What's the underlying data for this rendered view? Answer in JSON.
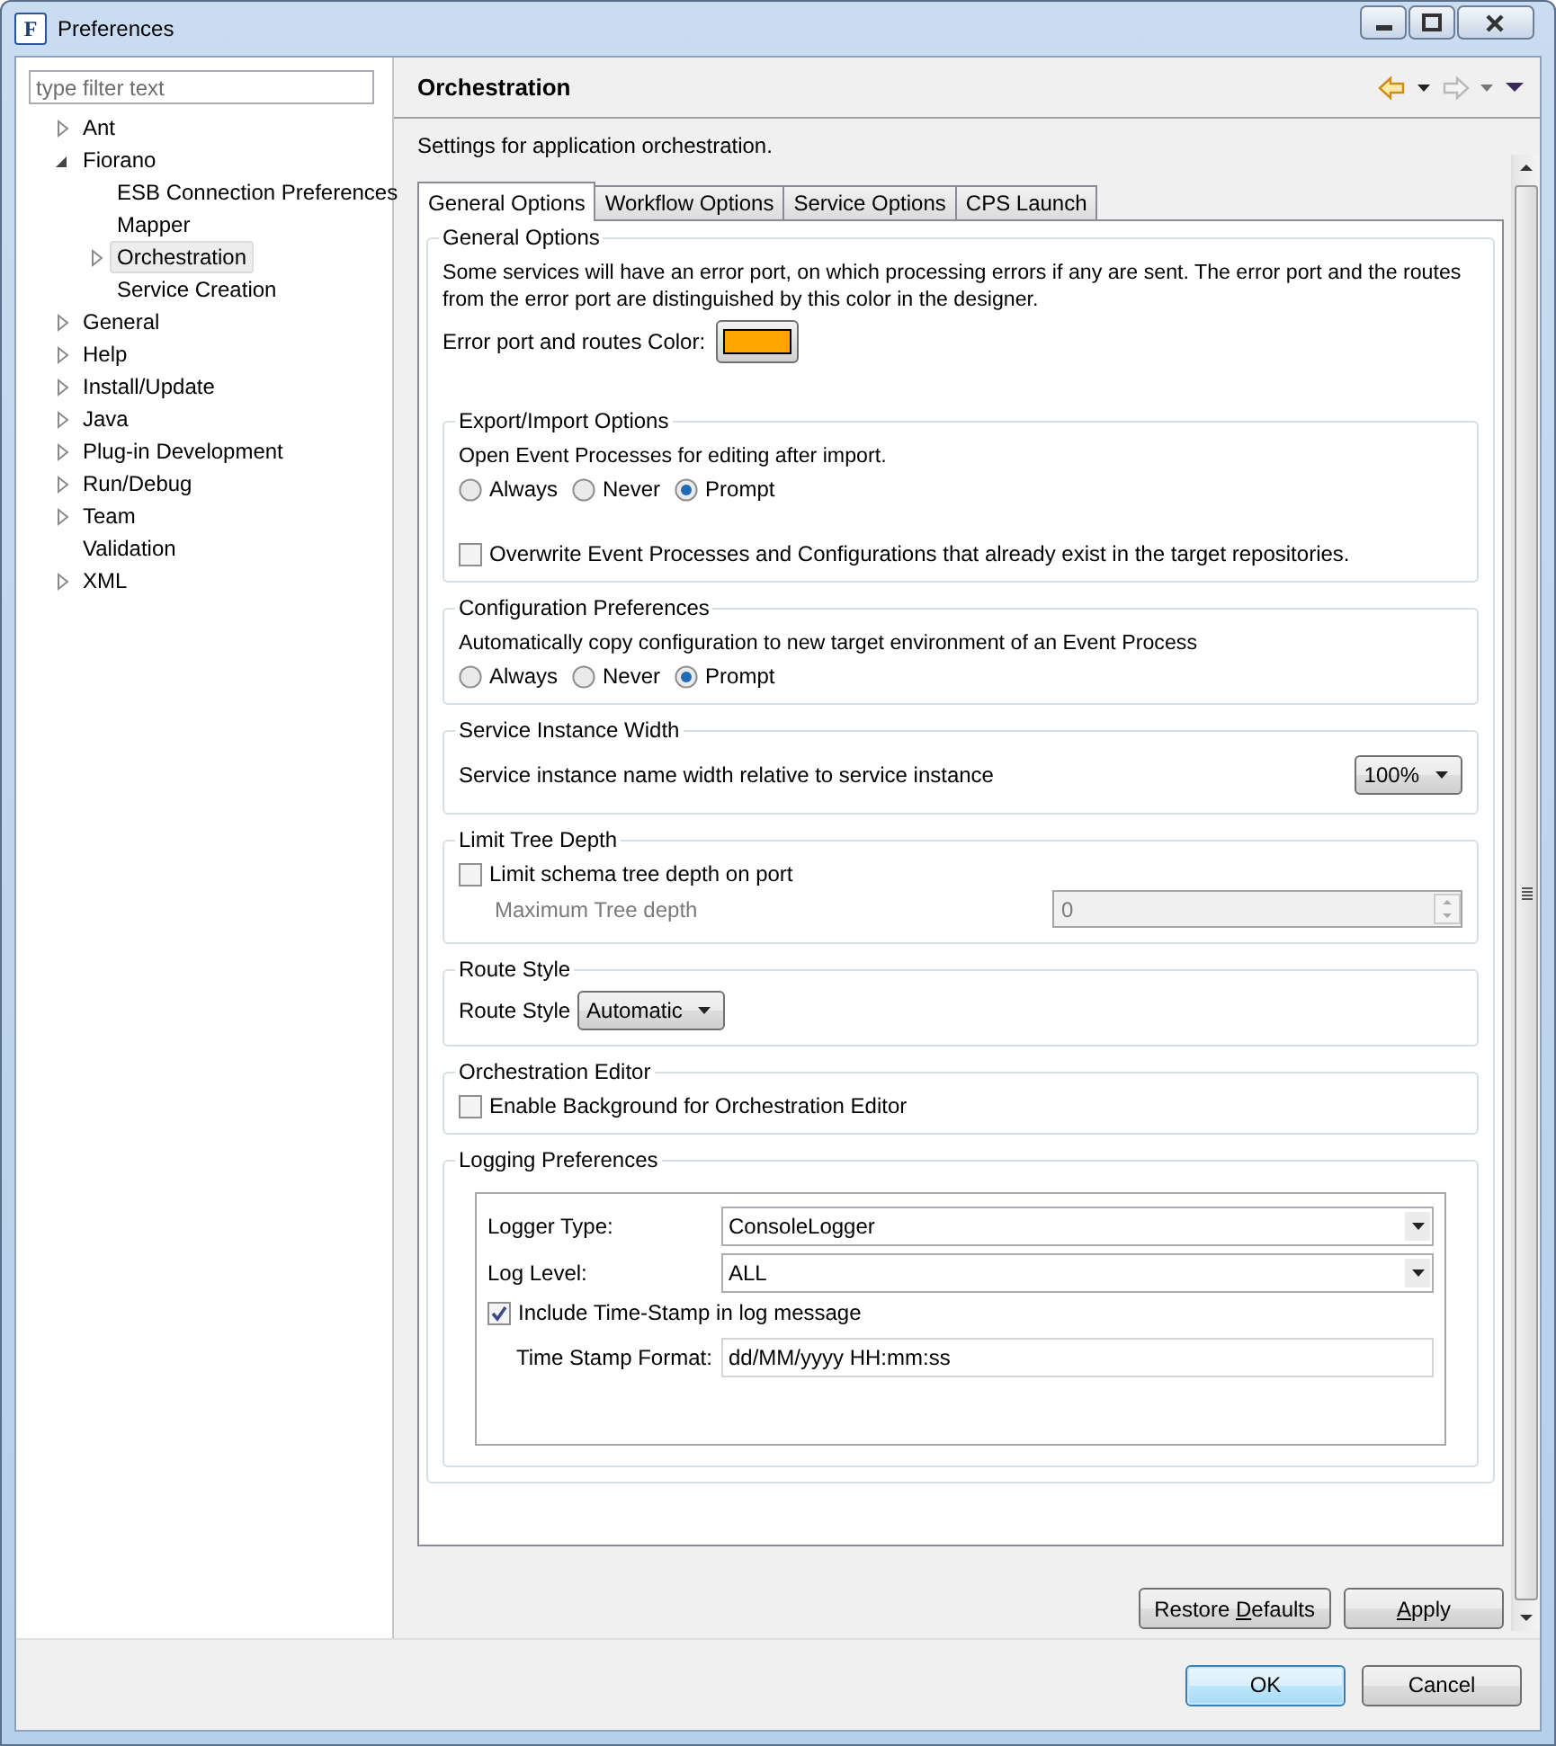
{
  "window": {
    "title": "Preferences",
    "icon_letter": "F"
  },
  "filter": {
    "placeholder": "type filter text"
  },
  "tree": [
    {
      "label": "Ant",
      "expandable": true,
      "expanded": false,
      "selected": false
    },
    {
      "label": "Fiorano",
      "expandable": true,
      "expanded": true,
      "selected": false,
      "children": [
        {
          "label": "ESB Connection Preferences",
          "expandable": false,
          "selected": false
        },
        {
          "label": "Mapper",
          "expandable": false,
          "selected": false
        },
        {
          "label": "Orchestration",
          "expandable": true,
          "expanded": false,
          "selected": true
        },
        {
          "label": "Service Creation",
          "expandable": false,
          "selected": false
        }
      ]
    },
    {
      "label": "General",
      "expandable": true,
      "expanded": false,
      "selected": false
    },
    {
      "label": "Help",
      "expandable": true,
      "expanded": false,
      "selected": false
    },
    {
      "label": "Install/Update",
      "expandable": true,
      "expanded": false,
      "selected": false
    },
    {
      "label": "Java",
      "expandable": true,
      "expanded": false,
      "selected": false
    },
    {
      "label": "Plug-in Development",
      "expandable": true,
      "expanded": false,
      "selected": false
    },
    {
      "label": "Run/Debug",
      "expandable": true,
      "expanded": false,
      "selected": false
    },
    {
      "label": "Team",
      "expandable": true,
      "expanded": false,
      "selected": false
    },
    {
      "label": "Validation",
      "expandable": false,
      "selected": false
    },
    {
      "label": "XML",
      "expandable": true,
      "expanded": false,
      "selected": false
    }
  ],
  "page": {
    "title": "Orchestration",
    "description": "Settings for application orchestration.",
    "back_disabled": false,
    "forward_disabled": true
  },
  "tabs": [
    {
      "label": "General Options",
      "selected": true
    },
    {
      "label": "Workflow Options",
      "selected": false
    },
    {
      "label": "Service Options",
      "selected": false
    },
    {
      "label": "CPS Launch",
      "selected": false
    }
  ],
  "groups": [
    {
      "title": "General Options",
      "items": [
        {
          "kind": "text",
          "text": "Some services will have an error port, on which processing errors if any are sent. The error port and the routes from the error port are distinguished by this color in the designer."
        },
        {
          "kind": "color",
          "label": "Error port and routes Color:",
          "color": "#ffa500"
        }
      ],
      "groups": [
        {
          "title": "Export/Import Options",
          "items": [
            {
              "kind": "text",
              "text": "Open Event Processes for editing after import."
            },
            {
              "kind": "radios",
              "options": [
                {
                  "label": "Always",
                  "selected": false
                },
                {
                  "label": "Never",
                  "selected": false
                },
                {
                  "label": "Prompt",
                  "selected": true
                }
              ]
            },
            {
              "kind": "checkbox",
              "label": "Overwrite Event Processes and Configurations that already exist in the target repositories.",
              "checked": false
            }
          ]
        },
        {
          "title": "Configuration Preferences",
          "items": [
            {
              "kind": "text",
              "text": "Automatically copy configuration to new target environment of an Event Process"
            },
            {
              "kind": "radios",
              "options": [
                {
                  "label": "Always",
                  "selected": false
                },
                {
                  "label": "Never",
                  "selected": false
                },
                {
                  "label": "Prompt",
                  "selected": true
                }
              ]
            }
          ]
        },
        {
          "title": "Service Instance Width",
          "items": [
            {
              "kind": "dropdown_split",
              "label": "Service instance name width relative to service instance",
              "value": "100%"
            }
          ]
        },
        {
          "title": "Limit Tree Depth",
          "items": [
            {
              "kind": "checkbox",
              "label": "Limit schema tree depth on port",
              "checked": false
            },
            {
              "kind": "spinner",
              "label": "Maximum Tree depth",
              "value": "0",
              "disabled": true
            }
          ]
        },
        {
          "title": "Route Style",
          "items": [
            {
              "kind": "dropdown_inline",
              "label": "Route Style",
              "value": "Automatic"
            }
          ]
        },
        {
          "title": "Orchestration Editor",
          "items": [
            {
              "kind": "checkbox",
              "label": "Enable Background for Orchestration Editor",
              "checked": false
            }
          ]
        },
        {
          "title": "Logging Preferences",
          "items": [
            {
              "kind": "panel",
              "rows": [
                {
                  "kind": "combo",
                  "label": "Logger Type:",
                  "value": "ConsoleLogger"
                },
                {
                  "kind": "combo",
                  "label": "Log Level:",
                  "value": "ALL"
                },
                {
                  "kind": "checkbox",
                  "label": "Include Time-Stamp in log message",
                  "checked": true
                },
                {
                  "kind": "field",
                  "label": "Time Stamp Format:",
                  "value": "dd/MM/yyyy HH:mm:ss"
                }
              ]
            }
          ]
        }
      ]
    }
  ],
  "page_buttons": [
    {
      "label": "Restore ",
      "mnemonic": "D",
      "rest": "efaults"
    },
    {
      "mnemonic": "A",
      "rest": "pply"
    }
  ],
  "dialog_buttons": [
    {
      "label": "OK",
      "default": true
    },
    {
      "label": "Cancel",
      "default": false
    }
  ]
}
